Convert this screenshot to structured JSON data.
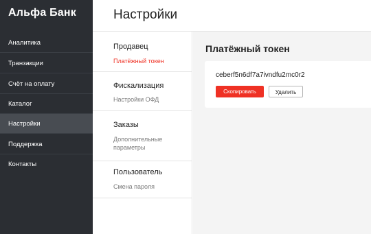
{
  "sidebar": {
    "logo": "Альфа Банк",
    "items": [
      {
        "label": "Аналитика",
        "active": false
      },
      {
        "label": "Транзакции",
        "active": false
      },
      {
        "label": "Счёт на оплату",
        "active": false
      },
      {
        "label": "Каталог",
        "active": false
      },
      {
        "label": "Настройки",
        "active": true
      },
      {
        "label": "Поддержка",
        "active": false
      },
      {
        "label": "Контакты",
        "active": false
      }
    ]
  },
  "header": {
    "title": "Настройки"
  },
  "submenu": {
    "groups": [
      {
        "title": "Продавец",
        "link": "Платёжный токен",
        "active": true
      },
      {
        "title": "Фискализация",
        "link": "Настройки ОФД",
        "active": false
      },
      {
        "title": "Заказы",
        "link_lines": [
          "Дополнительные",
          "параметры"
        ],
        "active": false
      },
      {
        "title": "Пользователь",
        "link": "Смена пароля",
        "active": false
      }
    ]
  },
  "main": {
    "title": "Платёжный токен",
    "token": "ceberf5n6df7a7ivndfu2mc0r2",
    "copy_label": "Скопировать",
    "delete_label": "Удалить"
  },
  "colors": {
    "sidebar": "#2b2e33",
    "accent": "#ef3124",
    "content_bg": "#f4f4f4"
  }
}
